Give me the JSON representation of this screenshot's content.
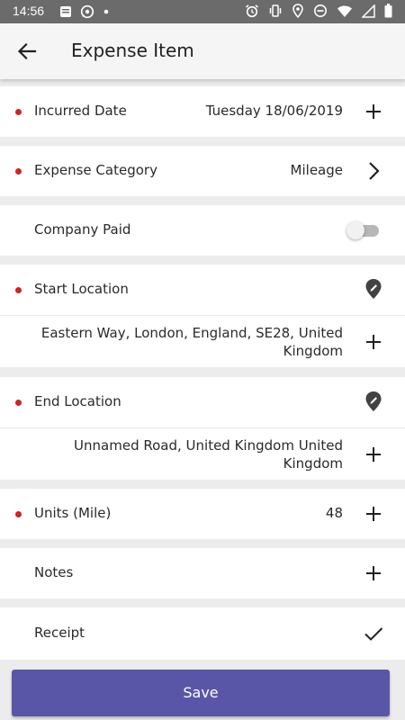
{
  "status_bar": {
    "time": "14:56",
    "left_icons": [
      "message-icon",
      "whatsapp-icon",
      "dot-icon"
    ],
    "right_icons": [
      "alarm-icon",
      "vibrate-icon",
      "location-icon",
      "dnd-icon",
      "wifi-icon",
      "signal-icon",
      "battery-icon"
    ]
  },
  "app_bar": {
    "title": "Expense Item",
    "back_icon": "arrow-back-icon"
  },
  "form": {
    "incurred_date": {
      "label": "Incurred Date",
      "value": "Tuesday 18/06/2019",
      "required": true
    },
    "expense_category": {
      "label": "Expense Category",
      "value": "Mileage",
      "required": true
    },
    "company_paid": {
      "label": "Company Paid",
      "checked": false
    },
    "start_location": {
      "label": "Start Location",
      "value": "Eastern Way, London, England, SE28, United Kingdom",
      "required": true
    },
    "end_location": {
      "label": "End Location",
      "value": "Unnamed Road, United Kingdom United Kingdom",
      "required": true
    },
    "units": {
      "label": "Units (Mile)",
      "value": "48",
      "required": true
    },
    "notes": {
      "label": "Notes"
    },
    "receipt": {
      "label": "Receipt"
    }
  },
  "save_button": {
    "label": "Save"
  },
  "colors": {
    "accent": "#5956a8",
    "required_dot": "#c62828",
    "status_bar": "#6b6b6b"
  }
}
